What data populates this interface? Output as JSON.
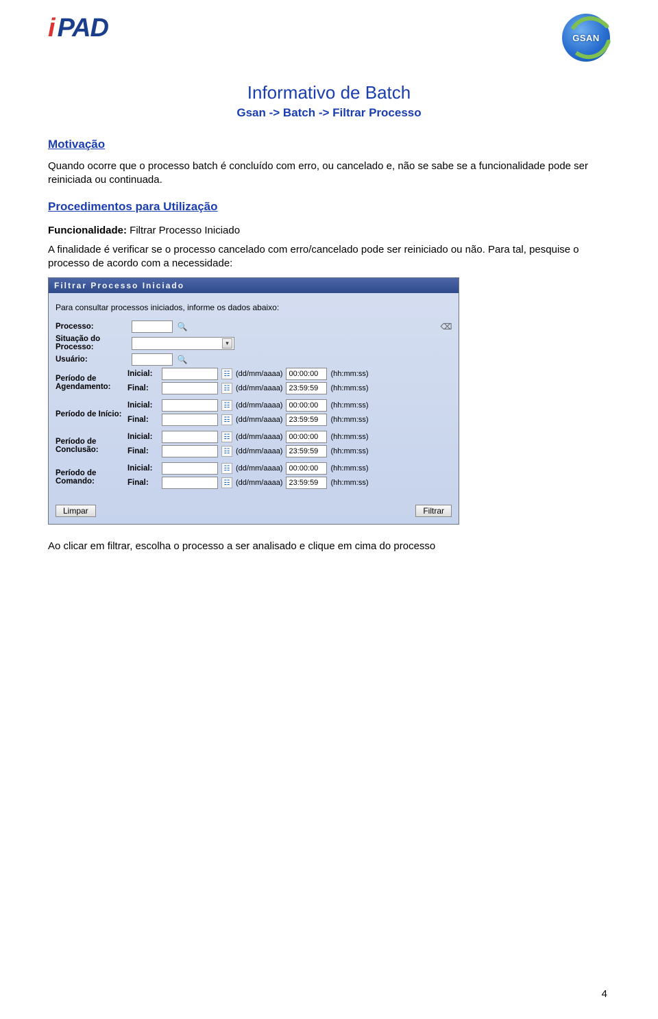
{
  "logos": {
    "ipad_i": "i",
    "ipad_pad": "PAD",
    "gsan_label": "GSAN"
  },
  "title": "Informativo de Batch",
  "breadcrumb": "Gsan -> Batch -> Filtrar Processo",
  "section_motivacao": "Motivação",
  "motivacao_text": "Quando ocorre que o processo batch é concluído com erro, ou cancelado e, não se sabe se a funcionalidade pode ser reiniciada ou continuada.",
  "section_proc": "Procedimentos para Utilização",
  "func_label": "Funcionalidade:",
  "func_value": " Filtrar Processo Iniciado",
  "finalidade_text": "A finalidade é verificar se o processo cancelado com erro/cancelado pode ser reiniciado ou não. Para tal, pesquise o processo de acordo com a necessidade:",
  "shot": {
    "panel_title": "Filtrar Processo Iniciado",
    "intro": "Para consultar processos iniciados, informe os dados abaixo:",
    "labels": {
      "processo": "Processo:",
      "situacao": "Situação do Processo:",
      "usuario": "Usuário:",
      "periodo_agendamento": "Período de Agendamento:",
      "periodo_inicio": "Período de Início:",
      "periodo_conclusao": "Período de Conclusão:",
      "periodo_comando": "Período de Comando:",
      "inicial": "Inicial:",
      "final": "Final:"
    },
    "hints": {
      "date": "(dd/mm/aaaa)",
      "time": "(hh:mm:ss)"
    },
    "time_defaults": {
      "start": "00:00:00",
      "end": "23:59:59"
    },
    "buttons": {
      "limpar": "Limpar",
      "filtrar": "Filtrar"
    }
  },
  "after_shot": "Ao clicar em filtrar, escolha o processo a ser analisado e clique em cima do processo",
  "page_number": "4"
}
